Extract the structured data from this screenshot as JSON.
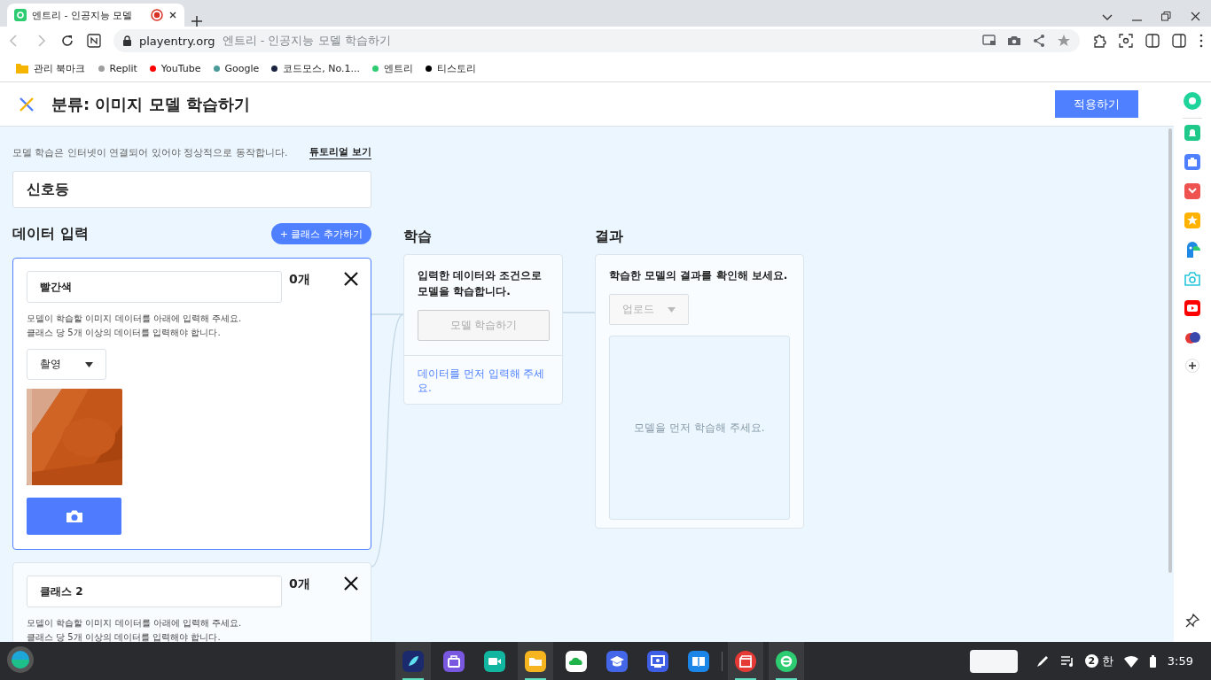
{
  "browser": {
    "tab": {
      "title": "엔트리 - 인공지능 모델",
      "recording": true
    },
    "url": "playentry.org",
    "page_title": "엔트리 - 인공지능 모델 학습하기",
    "bookmarks": [
      {
        "kind": "folder",
        "label": "관리 북마크"
      },
      {
        "kind": "dot",
        "label": "Replit",
        "color": "#9e9e9e"
      },
      {
        "kind": "dot",
        "label": "YouTube",
        "color": "#ff0000"
      },
      {
        "kind": "dot",
        "label": "Google",
        "color": "#4a9a9a"
      },
      {
        "kind": "dot",
        "label": "코드모스, No.1...",
        "color": "#1a2340"
      },
      {
        "kind": "dot",
        "label": "엔트리",
        "color": "#2ecc71"
      },
      {
        "kind": "dot",
        "label": "티스토리",
        "color": "#000000"
      }
    ]
  },
  "header": {
    "title": "분류: 이미지 모델 학습하기",
    "apply_button": "적용하기"
  },
  "notice": "모델 학습은 인터넷이 연결되어 있어야 정상적으로 동작합니다.",
  "tutorial_link": "튜토리얼 보기",
  "model_name": "신호등",
  "data_input": {
    "heading": "데이터 입력",
    "add_class_button": "+ 클래스 추가하기",
    "classes": [
      {
        "name": "빨간색",
        "count": "0개",
        "selected": true,
        "description": [
          "모델이 학습할 이미지 데이터를 아래에 입력해 주세요.",
          "클래스 당 5개 이상의 데이터를 입력해야 합니다."
        ],
        "source": "촬영",
        "has_picture": true
      },
      {
        "name": "클래스 2",
        "count": "0개",
        "selected": false,
        "description": [
          "모델이 학습할 이미지 데이터를 아래에 입력해 주세요.",
          "클래스 당 5개 이상의 데이터를 입력해야 합니다."
        ],
        "has_picture": false
      }
    ]
  },
  "training": {
    "heading": "학습",
    "description": "입력한 데이터와 조건으로 모델을 학습합니다.",
    "button": "모델 학습하기",
    "disabled": true,
    "warning": "데이터를 먼저 입력해 주세요."
  },
  "result": {
    "heading": "결과",
    "description": "학습한 모델의 결과를 확인해 보세요.",
    "dropdown": "업로드",
    "disabled": true,
    "placeholder": "모델을 먼저 학습해 주세요."
  },
  "taskbar": {
    "apps": [
      {
        "kind": "feather",
        "running": true
      },
      {
        "kind": "bag",
        "running": false
      },
      {
        "kind": "video",
        "running": false
      },
      {
        "kind": "folder",
        "running": true
      },
      {
        "kind": "cloud",
        "running": false
      },
      {
        "kind": "cap",
        "running": false
      },
      {
        "kind": "board",
        "running": false
      },
      {
        "kind": "book",
        "running": false
      },
      {
        "kind": "clapper",
        "running": true
      },
      {
        "kind": "entry",
        "running": true
      }
    ],
    "notifications": "2",
    "ime": "한",
    "time": "3:59"
  }
}
